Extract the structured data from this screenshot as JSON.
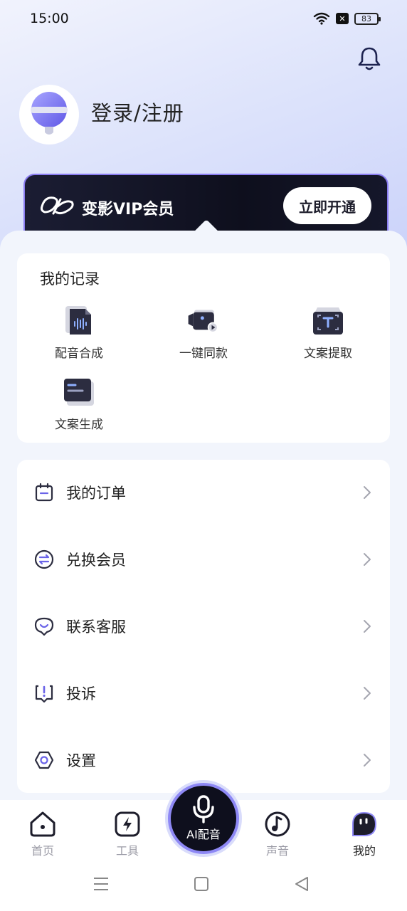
{
  "status_bar": {
    "time": "15:00",
    "battery": "83"
  },
  "profile": {
    "login_label": "登录/注册"
  },
  "vip": {
    "label": "变影VIP会员",
    "button": "立即开通"
  },
  "records": {
    "title": "我的记录",
    "items": [
      {
        "label": "配音合成",
        "icon": "audio-file-icon"
      },
      {
        "label": "一键同款",
        "icon": "video-camera-icon"
      },
      {
        "label": "文案提取",
        "icon": "text-extract-icon"
      },
      {
        "label": "文案生成",
        "icon": "text-generate-icon"
      }
    ]
  },
  "menu": [
    {
      "label": "我的订单",
      "icon": "order-icon"
    },
    {
      "label": "兑换会员",
      "icon": "exchange-icon"
    },
    {
      "label": "联系客服",
      "icon": "customer-service-icon"
    },
    {
      "label": "投诉",
      "icon": "complaint-icon"
    },
    {
      "label": "设置",
      "icon": "settings-icon"
    }
  ],
  "bottom_nav": {
    "tabs": [
      {
        "label": "首页",
        "icon": "home-icon"
      },
      {
        "label": "工具",
        "icon": "tools-icon"
      },
      {
        "label": "声音",
        "icon": "music-icon"
      },
      {
        "label": "我的",
        "icon": "profile-icon"
      }
    ],
    "center_label": "AI配音",
    "active": "我的"
  },
  "colors": {
    "accent": "#8e88f5",
    "dark": "#0e0f1d",
    "background": "#f2f5fc"
  }
}
